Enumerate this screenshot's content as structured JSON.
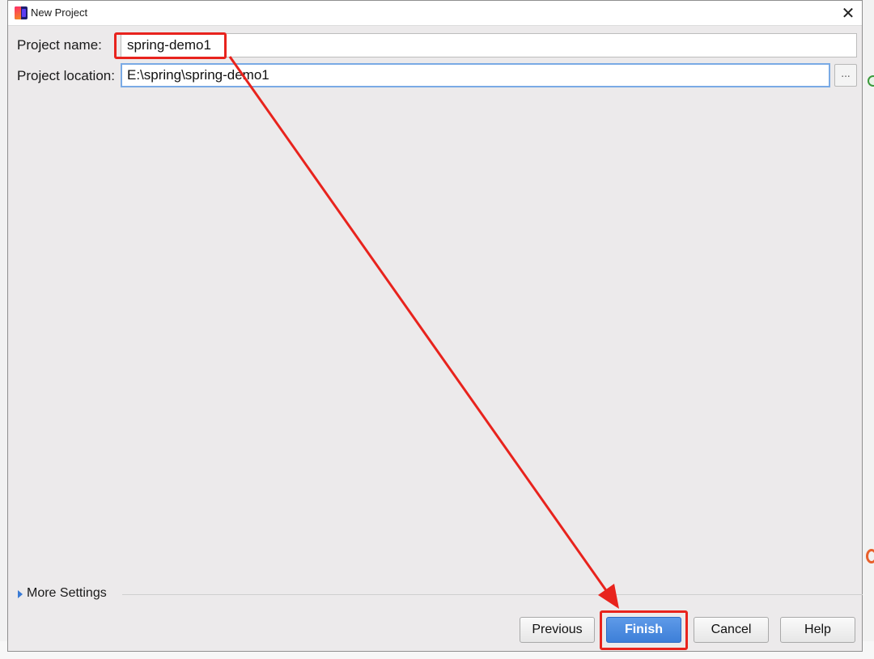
{
  "dialog": {
    "title": "New Project"
  },
  "form": {
    "project_name_label": "Project name:",
    "project_name_value": "spring-demo1",
    "project_location_label": "Project location:",
    "project_location_value": "E:\\spring\\spring-demo1",
    "browse_label": "..."
  },
  "more_settings": {
    "label": "More Settings"
  },
  "buttons": {
    "previous": "Previous",
    "finish": "Finish",
    "cancel": "Cancel",
    "help": "Help"
  },
  "colors": {
    "annotation_red": "#e8231d",
    "primary_blue": "#3d7fd8",
    "focus_border": "#7aaae5"
  }
}
